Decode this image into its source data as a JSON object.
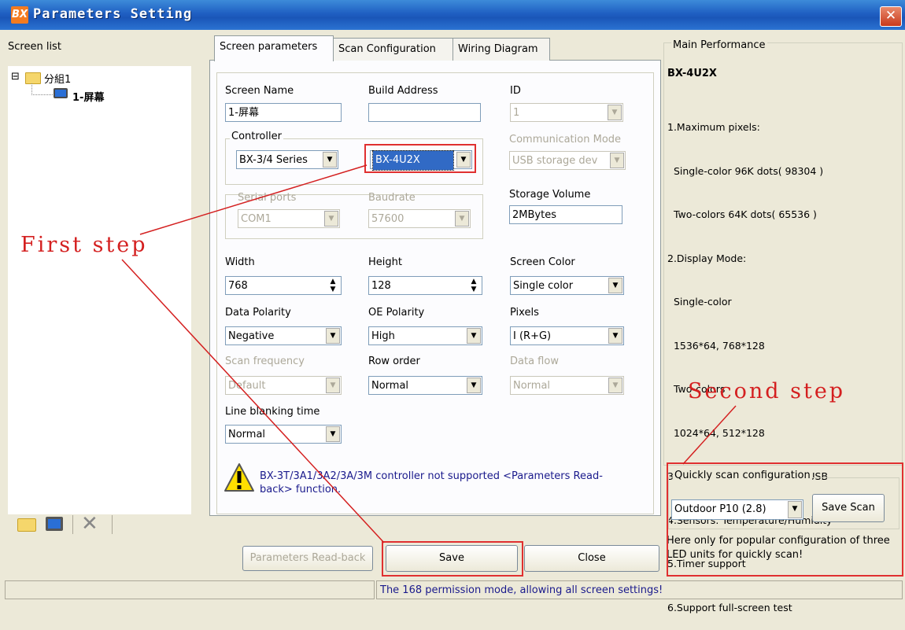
{
  "window": {
    "logo": "BX",
    "title": "Parameters Setting",
    "close_glyph": "✕"
  },
  "screen_list": {
    "label": "Screen list",
    "group_expander": "⊟",
    "group_label": "分組1",
    "screen_label": "1-屏幕",
    "toolbar_icons": [
      "folder-icon",
      "monitor-icon",
      "delete-icon"
    ]
  },
  "tabs": [
    "Screen parameters",
    "Scan Configuration",
    "Wiring Diagram"
  ],
  "form": {
    "screen_name": {
      "label": "Screen Name",
      "value": "1-屏幕"
    },
    "build_address": {
      "label": "Build Address",
      "value": ""
    },
    "id": {
      "label": "ID",
      "value": "1"
    },
    "controller": {
      "label": "Controller",
      "series": "BX-3/4 Series",
      "model": "BX-4U2X"
    },
    "communication_mode": {
      "label": "Communication Mode",
      "value": "USB storage dev"
    },
    "serial_ports": {
      "label": "Serial ports",
      "value": "COM1"
    },
    "baudrate": {
      "label": "Baudrate",
      "value": "57600"
    },
    "storage_volume": {
      "label": "Storage Volume",
      "value": "2MBytes"
    },
    "width": {
      "label": "Width",
      "value": "768"
    },
    "height": {
      "label": "Height",
      "value": "128"
    },
    "screen_color": {
      "label": "Screen Color",
      "value": "Single color"
    },
    "data_polarity": {
      "label": "Data Polarity",
      "value": "Negative"
    },
    "oe_polarity": {
      "label": "OE Polarity",
      "value": "High"
    },
    "pixels": {
      "label": "Pixels",
      "value": "I (R+G)"
    },
    "scan_frequency": {
      "label": "Scan frequency",
      "value": "Default"
    },
    "row_order": {
      "label": "Row order",
      "value": "Normal"
    },
    "data_flow": {
      "label": "Data flow",
      "value": "Normal"
    },
    "line_blanking_time": {
      "label": "Line blanking time",
      "value": "Normal"
    }
  },
  "warning": {
    "text": "BX-3T/3A1/3A2/3A/3M controller not supported <Parameters Read-back> function."
  },
  "buttons": {
    "read_back": "Parameters Read-back",
    "save": "Save",
    "close": "Close"
  },
  "main_performance": {
    "label": "Main Performance",
    "model": "BX-4U2X",
    "lines": [
      "1.Maximum pixels:",
      "  Single-color 96K dots( 98304 )",
      "  Two-colors 64K dots( 65536 )",
      "2.Display Mode:",
      "  Single-color",
      "  1536*64, 768*128",
      "  Two-colors",
      "  1024*64, 512*128",
      "3.Communication interface: USB",
      "4.Sensors: Temperature/Humidity",
      "5.Timer support",
      "6.Support full-screen test"
    ]
  },
  "quick_scan": {
    "label": "Quickly scan configuration",
    "value": "Outdoor P10 (2.8)",
    "save_scan": "Save Scan",
    "note": "Here only for popular configuration of three LED units for quickly scan!"
  },
  "annotations": {
    "first": "First step",
    "second": "Second step"
  },
  "status": {
    "message": "The 168 permission mode, allowing all screen settings!"
  },
  "colors": {
    "title_bar": "#1f5fc2",
    "annotation_red": "#d42020",
    "link_blue": "#1a1a8c"
  }
}
